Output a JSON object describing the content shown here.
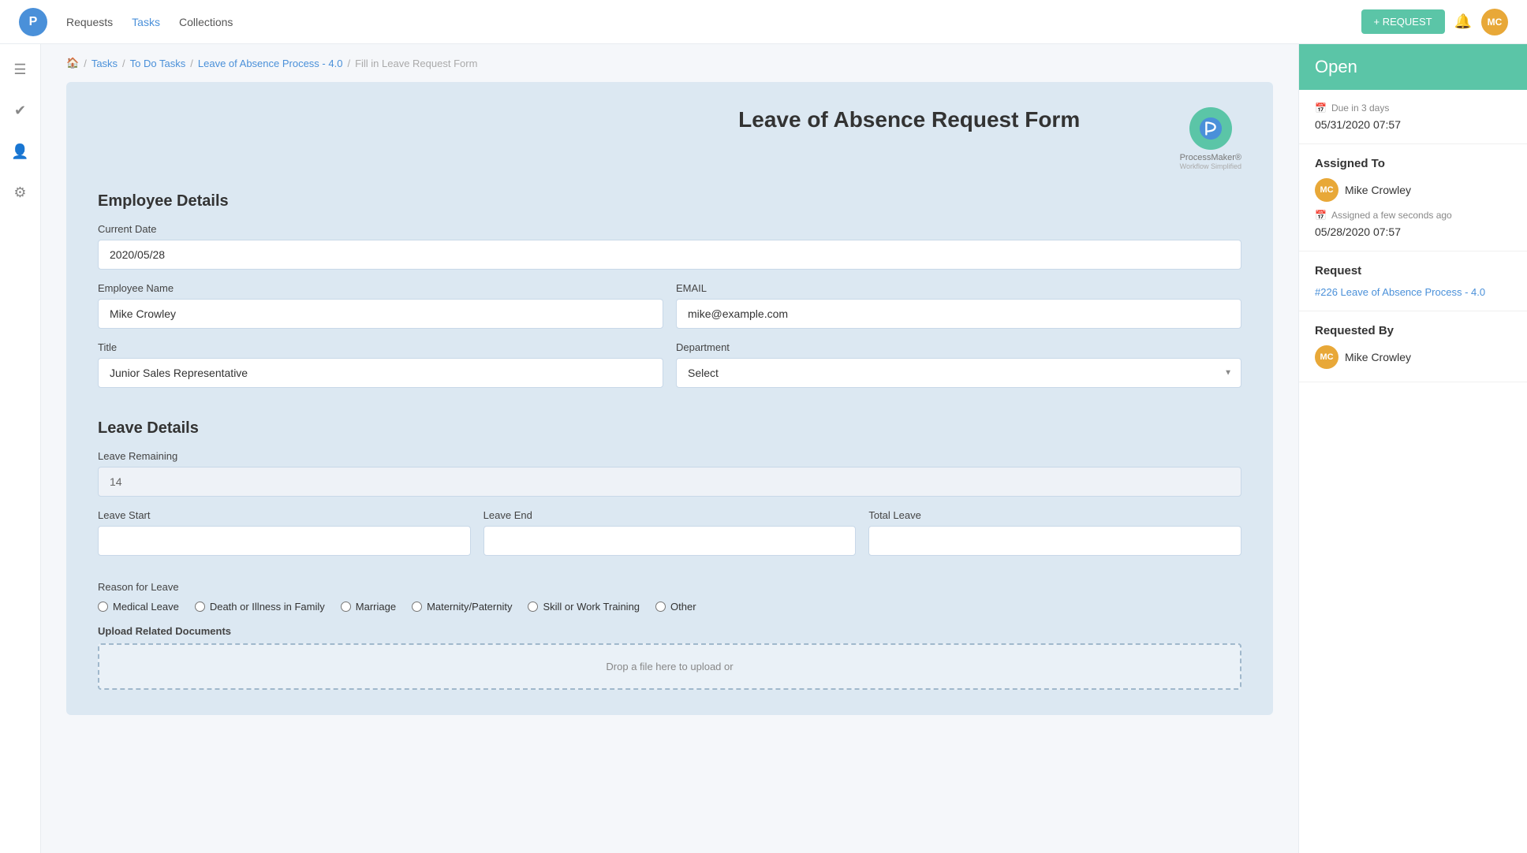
{
  "nav": {
    "logo_text": "P",
    "links": [
      {
        "label": "Requests",
        "active": false
      },
      {
        "label": "Tasks",
        "active": true
      },
      {
        "label": "Collections",
        "active": false
      }
    ],
    "request_button": "+ REQUEST",
    "avatar_initials": "MC"
  },
  "sidebar": {
    "icons": [
      {
        "name": "menu-icon",
        "symbol": "☰"
      },
      {
        "name": "tasks-icon",
        "symbol": "✓"
      },
      {
        "name": "users-icon",
        "symbol": "👤"
      },
      {
        "name": "settings-icon",
        "symbol": "⚙"
      }
    ]
  },
  "breadcrumb": {
    "home": "🏠",
    "items": [
      {
        "label": "Tasks",
        "link": true
      },
      {
        "label": "To Do Tasks",
        "link": true
      },
      {
        "label": "Leave of Absence Process - 4.0",
        "link": true
      },
      {
        "label": "Fill in Leave Request Form",
        "link": false
      }
    ]
  },
  "form": {
    "title": "Leave of Absence Request Form",
    "pm_logo_text": "ProcessMaker®",
    "pm_logo_sub": "Workflow Simplified",
    "sections": {
      "employee_details": {
        "title": "Employee Details",
        "fields": {
          "current_date_label": "Current Date",
          "current_date_value": "2020/05/28",
          "employee_name_label": "Employee Name",
          "employee_name_value": "Mike Crowley",
          "email_label": "EMAIL",
          "email_value": "mike@example.com",
          "title_label": "Title",
          "title_value": "Junior Sales Representative",
          "department_label": "Department",
          "department_placeholder": "Select"
        }
      },
      "leave_details": {
        "title": "Leave Details",
        "fields": {
          "leave_remaining_label": "Leave Remaining",
          "leave_remaining_value": "14",
          "leave_start_label": "Leave Start",
          "leave_start_value": "",
          "leave_end_label": "Leave End",
          "leave_end_value": "",
          "total_leave_label": "Total Leave",
          "total_leave_value": ""
        },
        "reason_label": "Reason for Leave",
        "reasons": [
          {
            "label": "Medical Leave",
            "value": "medical"
          },
          {
            "label": "Death or Illness in Family",
            "value": "death"
          },
          {
            "label": "Marriage",
            "value": "marriage"
          },
          {
            "label": "Maternity/Paternity",
            "value": "maternity"
          },
          {
            "label": "Skill or Work Training",
            "value": "skill"
          },
          {
            "label": "Other",
            "value": "other"
          }
        ],
        "upload_title": "Upload Related Documents",
        "upload_placeholder": "Drop a file here to upload or"
      }
    }
  },
  "right_panel": {
    "status": "Open",
    "due_label": "Due in 3 days",
    "due_date": "05/31/2020 07:57",
    "assigned_to_label": "Assigned To",
    "assigned_avatar": "MC",
    "assigned_name": "Mike Crowley",
    "assigned_time_label": "Assigned a few seconds ago",
    "assigned_date": "05/28/2020 07:57",
    "request_label": "Request",
    "request_link_text": "#226 Leave of Absence Process - 4.0",
    "requested_by_label": "Requested By",
    "requested_avatar": "MC",
    "requested_name": "Mike Crowley"
  }
}
